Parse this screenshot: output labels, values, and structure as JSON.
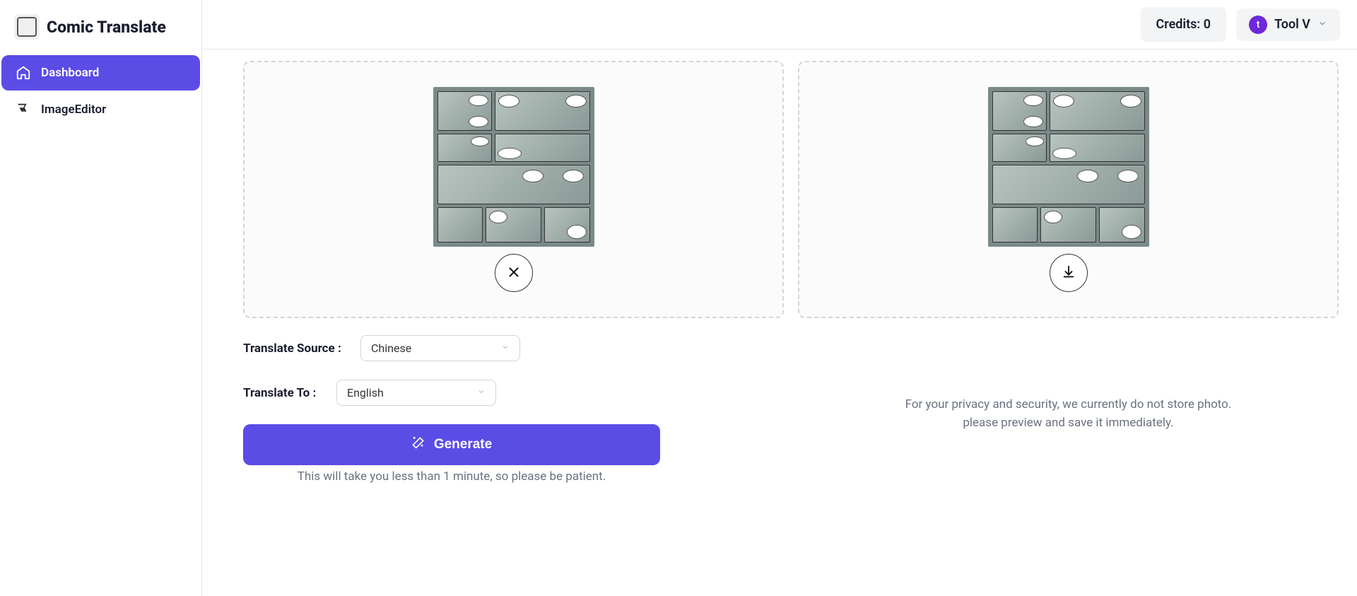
{
  "brand": {
    "title": "Comic Translate"
  },
  "sidebar": {
    "items": [
      {
        "label": "Dashboard"
      },
      {
        "label": "ImageEditor"
      }
    ]
  },
  "topbar": {
    "credits_label": "Credits: 0",
    "user_initial": "t",
    "user_label": "Tool V"
  },
  "controls": {
    "source_label": "Translate Source :",
    "source_value": "Chinese",
    "to_label": "Translate To :",
    "to_value": "English",
    "generate_label": "Generate",
    "subnote": "This will take you less than 1 minute, so please be patient."
  },
  "right": {
    "privacy_line1": "For your privacy and security, we currently do not store photo.",
    "privacy_line2": "please preview and save it immediately."
  }
}
